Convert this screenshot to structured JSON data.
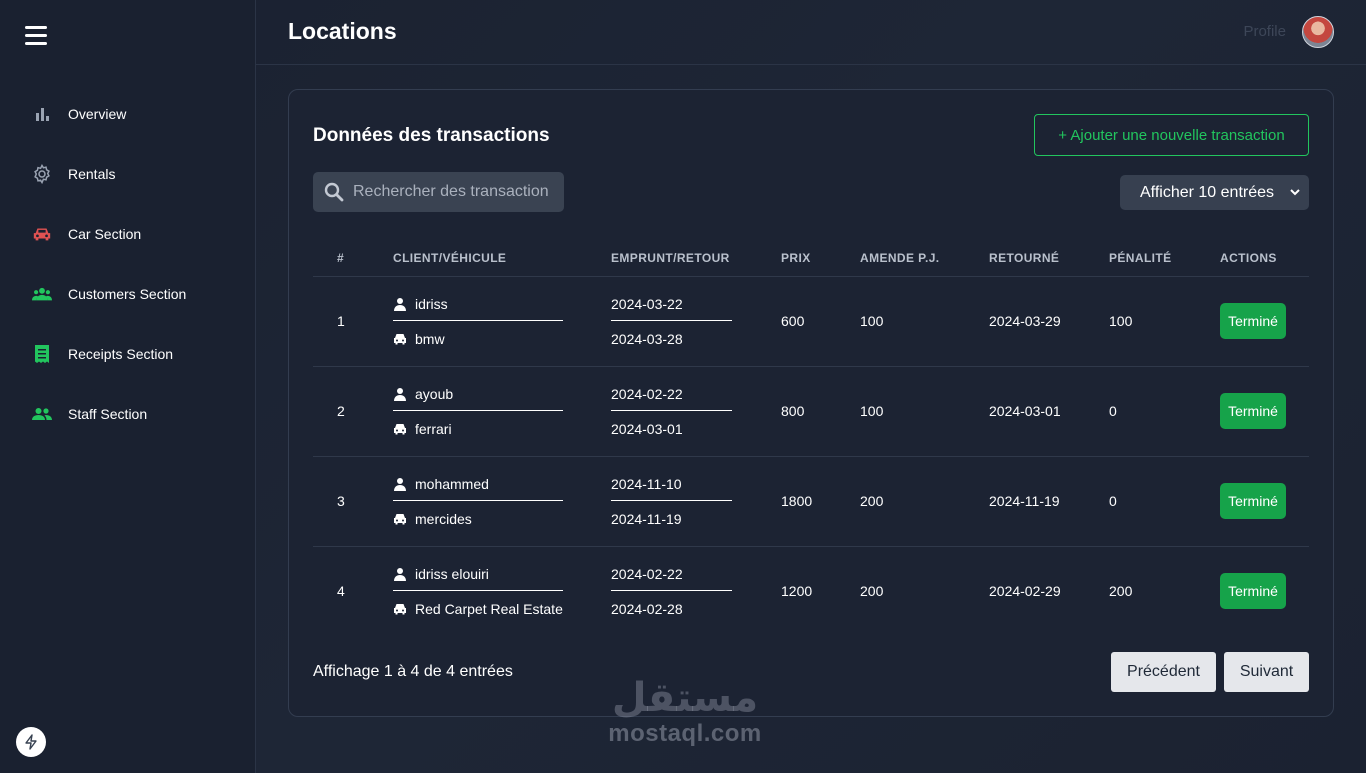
{
  "colors": {
    "accent_green": "#22c55e",
    "status_green": "#16a34a",
    "car_red": "#e05252",
    "icon_green": "#22c55e"
  },
  "sidebar": {
    "menu_icon": "hamburger-icon",
    "items": [
      {
        "label": "Overview",
        "icon": "bar-chart-icon"
      },
      {
        "label": "Rentals",
        "icon": "gear-icon"
      },
      {
        "label": "Car Section",
        "icon": "car-icon"
      },
      {
        "label": "Customers Section",
        "icon": "users-icon"
      },
      {
        "label": "Receipts Section",
        "icon": "receipt-icon"
      },
      {
        "label": "Staff Section",
        "icon": "group-icon"
      }
    ],
    "bottom_icon": "bolt-icon"
  },
  "header": {
    "title": "Locations",
    "profile_label": "Profile"
  },
  "card": {
    "title": "Données des transactions",
    "add_button": "+ Ajouter une nouvelle transaction",
    "search_placeholder": "Rechercher des transaction",
    "entries_select": "Afficher 10 entrées"
  },
  "table": {
    "columns": [
      "#",
      "CLIENT/VÉHICULE",
      "EMPRUNT/RETOUR",
      "PRIX",
      "AMENDE P.J.",
      "RETOURNÉ",
      "PÉNALITÉ",
      "ACTIONS"
    ],
    "rows": [
      {
        "num": "1",
        "client": "idriss",
        "vehicle": "bmw",
        "borrow": "2024-03-22",
        "return": "2024-03-28",
        "price": "600",
        "fine": "100",
        "returned": "2024-03-29",
        "penalty": "100",
        "status": "Terminé"
      },
      {
        "num": "2",
        "client": "ayoub",
        "vehicle": "ferrari",
        "borrow": "2024-02-22",
        "return": "2024-03-01",
        "price": "800",
        "fine": "100",
        "returned": "2024-03-01",
        "penalty": "0",
        "status": "Terminé"
      },
      {
        "num": "3",
        "client": "mohammed",
        "vehicle": "mercides",
        "borrow": "2024-11-10",
        "return": "2024-11-19",
        "price": "1800",
        "fine": "200",
        "returned": "2024-11-19",
        "penalty": "0",
        "status": "Terminé"
      },
      {
        "num": "4",
        "client": "idriss elouiri",
        "vehicle": "Red Carpet Real Estate",
        "borrow": "2024-02-22",
        "return": "2024-02-28",
        "price": "1200",
        "fine": "200",
        "returned": "2024-02-29",
        "penalty": "200",
        "status": "Terminé"
      }
    ]
  },
  "footer": {
    "summary": "Affichage 1 à 4 de 4 entrées",
    "prev": "Précédent",
    "next": "Suivant"
  },
  "watermark": {
    "arabic": "مستقل",
    "latin": "mostaql.com"
  }
}
